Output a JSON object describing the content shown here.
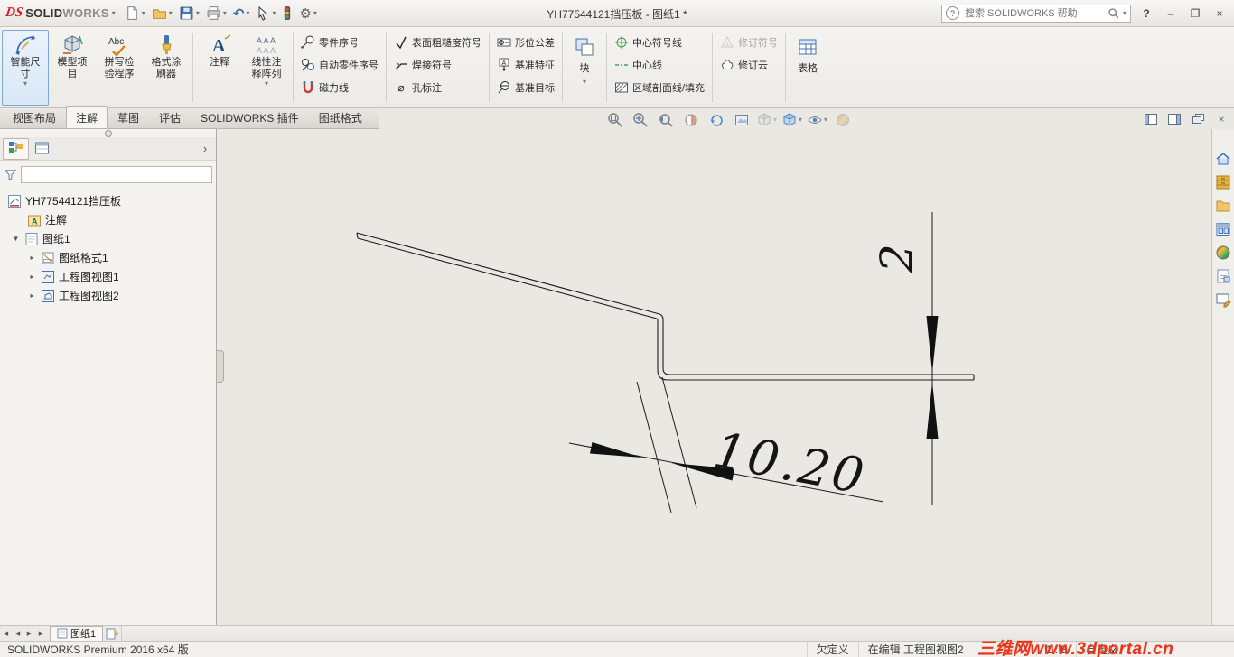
{
  "icons": {
    "caret_down": "▾",
    "chevron_right": "›",
    "expander_open": "▼",
    "expander_closed": "▸",
    "nav_prev": "◀",
    "nav_next": "▶",
    "minimize": "–",
    "restore": "❐",
    "close": "×",
    "gear": "⚙",
    "undo": "↶",
    "hole": "⌀",
    "gtol": "⊕",
    "check": "✓",
    "dash_dot": "— · —"
  },
  "titlebar": {
    "brand_ds": "DS",
    "brand_solid": "SOLID",
    "brand_works": "WORKS",
    "title": "YH77544121挡压板 - 图纸1 *",
    "search_placeholder": "搜索 SOLIDWORKS 帮助",
    "help": "?"
  },
  "tabs": {
    "items": [
      {
        "label": "视图布局"
      },
      {
        "label": "注解"
      },
      {
        "label": "草图"
      },
      {
        "label": "评估"
      },
      {
        "label": "SOLIDWORKS 插件"
      },
      {
        "label": "图纸格式"
      }
    ]
  },
  "ribbon": {
    "large": [
      {
        "label": "智能尺寸"
      },
      {
        "label": "模型项目"
      },
      {
        "label": "拼写检验程序"
      },
      {
        "label": "格式涂刷器"
      },
      {
        "label": "注释"
      },
      {
        "label": "线性注释阵列"
      }
    ],
    "col1": [
      {
        "label": "零件序号"
      },
      {
        "label": "自动零件序号"
      },
      {
        "label": "磁力线"
      }
    ],
    "col2": [
      {
        "label": "表面粗糙度符号"
      },
      {
        "label": "焊接符号"
      },
      {
        "label": "孔标注"
      }
    ],
    "col3": [
      {
        "label": "形位公差"
      },
      {
        "label": "基准特征"
      },
      {
        "label": "基准目标"
      }
    ],
    "blocks": {
      "label": "块"
    },
    "col4": [
      {
        "label": "中心符号线"
      },
      {
        "label": "中心线"
      },
      {
        "label": "区域剖面线/填充"
      }
    ],
    "col5": [
      {
        "label": "修订符号"
      },
      {
        "label": "修订云"
      }
    ],
    "tables": {
      "label": "表格"
    }
  },
  "feature_tree": {
    "root": "YH77544121挡压板",
    "items": [
      {
        "label": "注解"
      },
      {
        "label": "图纸1"
      },
      {
        "label": "图纸格式1"
      },
      {
        "label": "工程图视图1"
      },
      {
        "label": "工程图视图2"
      }
    ]
  },
  "drawing": {
    "dim_width": "10.20",
    "dim_thickness": "2"
  },
  "sheet_bar": {
    "tab": "图纸1"
  },
  "status_bar": {
    "app_version": "SOLIDWORKS Premium 2016 x64 版",
    "definition_state": "欠定义",
    "editing": "在编辑 工程图视图2",
    "scale": "1 : 5",
    "custom": "自定义"
  },
  "watermark": {
    "text": "三维网www.3dportal.cn"
  }
}
